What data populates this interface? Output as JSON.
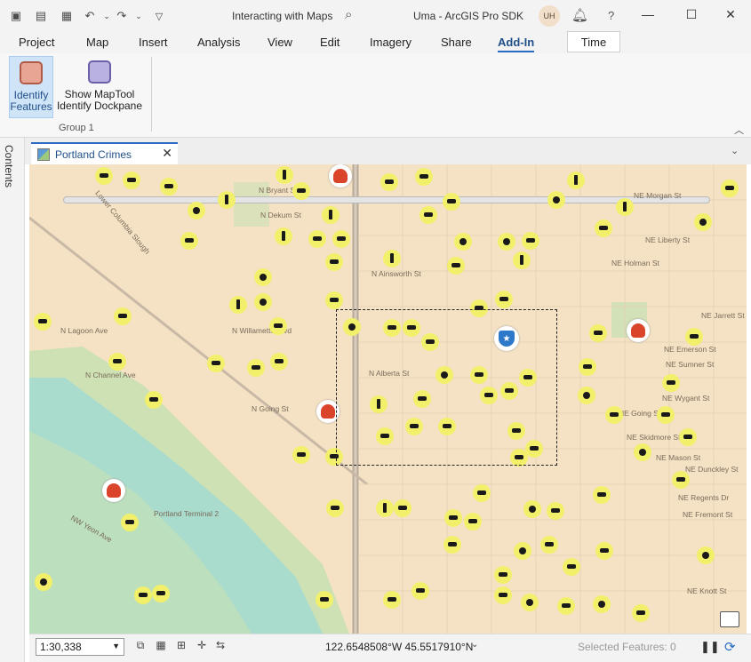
{
  "titlebar": {
    "quick_access": [
      "new-project-icon",
      "open-project-icon",
      "save-project-icon",
      "undo-icon",
      "redo-icon",
      "customize-icon"
    ],
    "search_label": "Interacting with Maps",
    "project_name": "Uma - ArcGIS Pro SDK",
    "user_initials": "UH",
    "help": "?",
    "window_buttons": {
      "minimize": "—",
      "maximize": "☐",
      "close": "✕"
    }
  },
  "ribbon": {
    "tabs": [
      "Project",
      "Map",
      "Insert",
      "Analysis",
      "View",
      "Edit",
      "Imagery",
      "Share",
      "Add-In"
    ],
    "active_tab": "Add-In",
    "time_tab": "Time",
    "buttons": [
      {
        "label_line1": "Identify",
        "label_line2": "Features",
        "icon_color": "#e8a594"
      },
      {
        "label_line1": "Show MapTool",
        "label_line2": "Identify Dockpane",
        "icon_color": "#b9b2e0"
      }
    ],
    "group_label": "Group 1"
  },
  "side_pane": {
    "label": "Contents"
  },
  "map_tab": {
    "label": "Portland Crimes"
  },
  "map": {
    "streets": [
      "N Bryant St",
      "N Dekum St",
      "N Ainsworth St",
      "N Willamette Blvd",
      "N Alberta St",
      "N Going St",
      "NE Morgan St",
      "NE Liberty St",
      "NE Holman St",
      "NE Jarrett St",
      "NE Emerson St",
      "NE Sumner St",
      "NE Wygant St",
      "NE Going St",
      "NE Skidmore St",
      "NE Mason St",
      "NE Fremont St",
      "NE Knott St",
      "NE Dunckley St",
      "NE Regents Dr",
      "NW Yeon Ave",
      "Portland Terminal 2",
      "N Lagoon Ave",
      "N Channel Ave",
      "Lower Columbia Slough"
    ],
    "colors": {
      "land": "#f5e2c4",
      "water": "#a9dccd",
      "park": "#c9e1b4",
      "crime_symbol": "#f2f06b",
      "fire": "#d9442b",
      "police": "#2d78c8"
    }
  },
  "statusbar": {
    "scale": "1:30,338",
    "coordinates": "122.6548508°W 45.5517910°N",
    "selected_features": "Selected Features: 0"
  }
}
